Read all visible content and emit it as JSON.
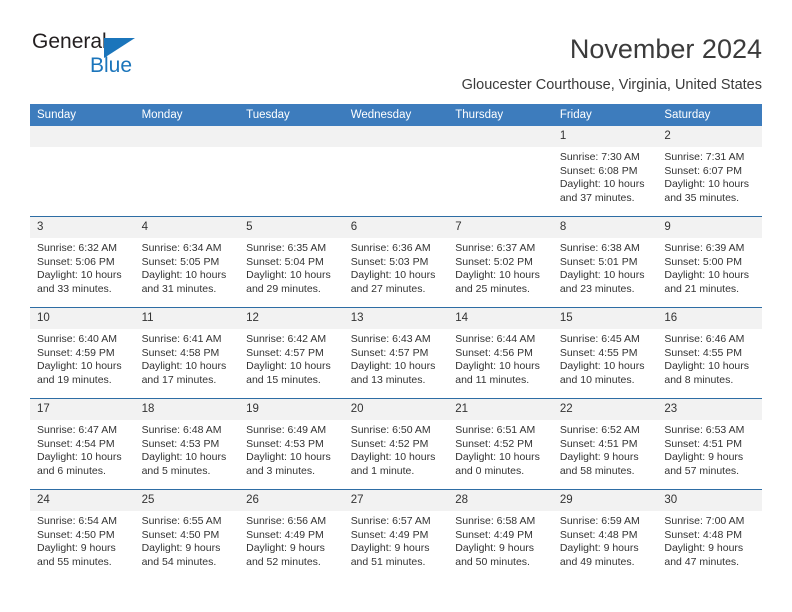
{
  "brand": {
    "name_top": "General",
    "name_bottom": "Blue",
    "triangle_color": "#1b75bb"
  },
  "header": {
    "title": "November 2024",
    "subtitle": "Gloucester Courthouse, Virginia, United States"
  },
  "theme": {
    "header_blue": "#3d7cbd",
    "divider_blue": "#2e6da4",
    "date_band_gray": "#f2f2f2"
  },
  "calendar": {
    "weekday_headers": [
      "Sunday",
      "Monday",
      "Tuesday",
      "Wednesday",
      "Thursday",
      "Friday",
      "Saturday"
    ],
    "weeks": [
      [
        {
          "day": "",
          "empty": true
        },
        {
          "day": "",
          "empty": true
        },
        {
          "day": "",
          "empty": true
        },
        {
          "day": "",
          "empty": true
        },
        {
          "day": "",
          "empty": true
        },
        {
          "day": "1",
          "sunrise": "Sunrise: 7:30 AM",
          "sunset": "Sunset: 6:08 PM",
          "daylight": "Daylight: 10 hours and 37 minutes."
        },
        {
          "day": "2",
          "sunrise": "Sunrise: 7:31 AM",
          "sunset": "Sunset: 6:07 PM",
          "daylight": "Daylight: 10 hours and 35 minutes."
        }
      ],
      [
        {
          "day": "3",
          "sunrise": "Sunrise: 6:32 AM",
          "sunset": "Sunset: 5:06 PM",
          "daylight": "Daylight: 10 hours and 33 minutes."
        },
        {
          "day": "4",
          "sunrise": "Sunrise: 6:34 AM",
          "sunset": "Sunset: 5:05 PM",
          "daylight": "Daylight: 10 hours and 31 minutes."
        },
        {
          "day": "5",
          "sunrise": "Sunrise: 6:35 AM",
          "sunset": "Sunset: 5:04 PM",
          "daylight": "Daylight: 10 hours and 29 minutes."
        },
        {
          "day": "6",
          "sunrise": "Sunrise: 6:36 AM",
          "sunset": "Sunset: 5:03 PM",
          "daylight": "Daylight: 10 hours and 27 minutes."
        },
        {
          "day": "7",
          "sunrise": "Sunrise: 6:37 AM",
          "sunset": "Sunset: 5:02 PM",
          "daylight": "Daylight: 10 hours and 25 minutes."
        },
        {
          "day": "8",
          "sunrise": "Sunrise: 6:38 AM",
          "sunset": "Sunset: 5:01 PM",
          "daylight": "Daylight: 10 hours and 23 minutes."
        },
        {
          "day": "9",
          "sunrise": "Sunrise: 6:39 AM",
          "sunset": "Sunset: 5:00 PM",
          "daylight": "Daylight: 10 hours and 21 minutes."
        }
      ],
      [
        {
          "day": "10",
          "sunrise": "Sunrise: 6:40 AM",
          "sunset": "Sunset: 4:59 PM",
          "daylight": "Daylight: 10 hours and 19 minutes."
        },
        {
          "day": "11",
          "sunrise": "Sunrise: 6:41 AM",
          "sunset": "Sunset: 4:58 PM",
          "daylight": "Daylight: 10 hours and 17 minutes."
        },
        {
          "day": "12",
          "sunrise": "Sunrise: 6:42 AM",
          "sunset": "Sunset: 4:57 PM",
          "daylight": "Daylight: 10 hours and 15 minutes."
        },
        {
          "day": "13",
          "sunrise": "Sunrise: 6:43 AM",
          "sunset": "Sunset: 4:57 PM",
          "daylight": "Daylight: 10 hours and 13 minutes."
        },
        {
          "day": "14",
          "sunrise": "Sunrise: 6:44 AM",
          "sunset": "Sunset: 4:56 PM",
          "daylight": "Daylight: 10 hours and 11 minutes."
        },
        {
          "day": "15",
          "sunrise": "Sunrise: 6:45 AM",
          "sunset": "Sunset: 4:55 PM",
          "daylight": "Daylight: 10 hours and 10 minutes."
        },
        {
          "day": "16",
          "sunrise": "Sunrise: 6:46 AM",
          "sunset": "Sunset: 4:55 PM",
          "daylight": "Daylight: 10 hours and 8 minutes."
        }
      ],
      [
        {
          "day": "17",
          "sunrise": "Sunrise: 6:47 AM",
          "sunset": "Sunset: 4:54 PM",
          "daylight": "Daylight: 10 hours and 6 minutes."
        },
        {
          "day": "18",
          "sunrise": "Sunrise: 6:48 AM",
          "sunset": "Sunset: 4:53 PM",
          "daylight": "Daylight: 10 hours and 5 minutes."
        },
        {
          "day": "19",
          "sunrise": "Sunrise: 6:49 AM",
          "sunset": "Sunset: 4:53 PM",
          "daylight": "Daylight: 10 hours and 3 minutes."
        },
        {
          "day": "20",
          "sunrise": "Sunrise: 6:50 AM",
          "sunset": "Sunset: 4:52 PM",
          "daylight": "Daylight: 10 hours and 1 minute."
        },
        {
          "day": "21",
          "sunrise": "Sunrise: 6:51 AM",
          "sunset": "Sunset: 4:52 PM",
          "daylight": "Daylight: 10 hours and 0 minutes."
        },
        {
          "day": "22",
          "sunrise": "Sunrise: 6:52 AM",
          "sunset": "Sunset: 4:51 PM",
          "daylight": "Daylight: 9 hours and 58 minutes."
        },
        {
          "day": "23",
          "sunrise": "Sunrise: 6:53 AM",
          "sunset": "Sunset: 4:51 PM",
          "daylight": "Daylight: 9 hours and 57 minutes."
        }
      ],
      [
        {
          "day": "24",
          "sunrise": "Sunrise: 6:54 AM",
          "sunset": "Sunset: 4:50 PM",
          "daylight": "Daylight: 9 hours and 55 minutes."
        },
        {
          "day": "25",
          "sunrise": "Sunrise: 6:55 AM",
          "sunset": "Sunset: 4:50 PM",
          "daylight": "Daylight: 9 hours and 54 minutes."
        },
        {
          "day": "26",
          "sunrise": "Sunrise: 6:56 AM",
          "sunset": "Sunset: 4:49 PM",
          "daylight": "Daylight: 9 hours and 52 minutes."
        },
        {
          "day": "27",
          "sunrise": "Sunrise: 6:57 AM",
          "sunset": "Sunset: 4:49 PM",
          "daylight": "Daylight: 9 hours and 51 minutes."
        },
        {
          "day": "28",
          "sunrise": "Sunrise: 6:58 AM",
          "sunset": "Sunset: 4:49 PM",
          "daylight": "Daylight: 9 hours and 50 minutes."
        },
        {
          "day": "29",
          "sunrise": "Sunrise: 6:59 AM",
          "sunset": "Sunset: 4:48 PM",
          "daylight": "Daylight: 9 hours and 49 minutes."
        },
        {
          "day": "30",
          "sunrise": "Sunrise: 7:00 AM",
          "sunset": "Sunset: 4:48 PM",
          "daylight": "Daylight: 9 hours and 47 minutes."
        }
      ]
    ]
  }
}
